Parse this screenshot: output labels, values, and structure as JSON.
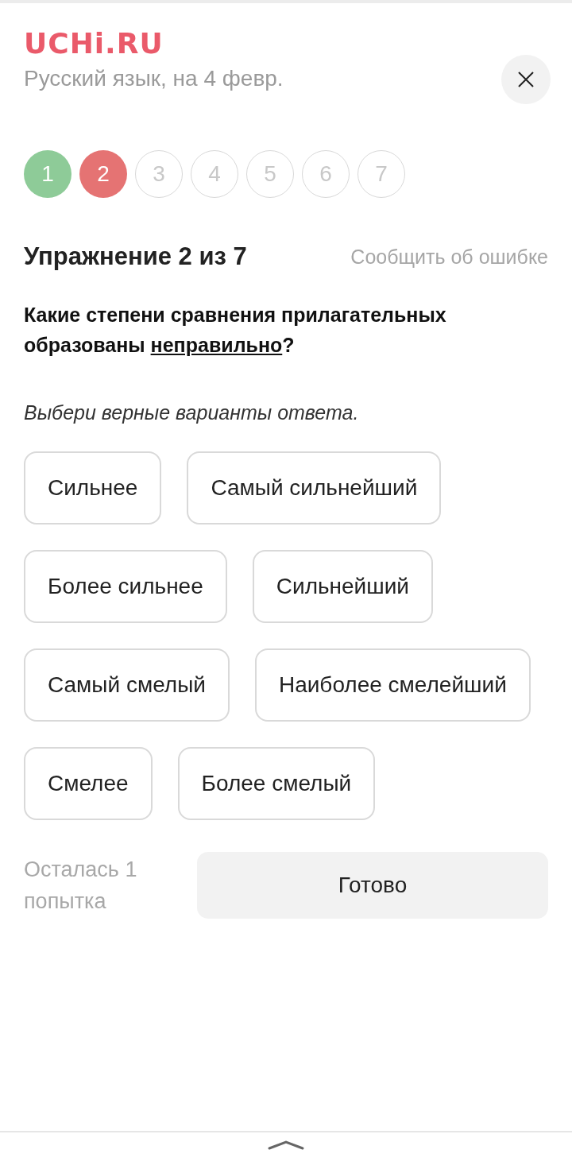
{
  "header": {
    "logo": "UCHi.RU",
    "subtitle": "Русский язык, на 4 февр."
  },
  "steps": [
    {
      "label": "1",
      "kind": "correct"
    },
    {
      "label": "2",
      "kind": "wrong"
    },
    {
      "label": "3",
      "kind": "pending"
    },
    {
      "label": "4",
      "kind": "pending"
    },
    {
      "label": "5",
      "kind": "pending"
    },
    {
      "label": "6",
      "kind": "pending"
    },
    {
      "label": "7",
      "kind": "pending"
    }
  ],
  "exercise": {
    "title": "Упражнение 2 из 7",
    "report_link": "Сообщить об ошибке"
  },
  "question": {
    "before": "Какие степени сравнения прилагательных образованы ",
    "underlined": "неправильно",
    "after": "?"
  },
  "instruction": "Выбери верные варианты ответа.",
  "option_rows": [
    [
      {
        "label": "Сильнее",
        "selected": false
      },
      {
        "label": "Самый сильнейший",
        "selected": false
      }
    ],
    [
      {
        "label": "Более сильнее",
        "selected": false
      },
      {
        "label": "Сильнейший",
        "selected": false
      }
    ],
    [
      {
        "label": "Самый смелый",
        "selected": false
      },
      {
        "label": "Наиболее смелейший",
        "selected": false
      }
    ],
    [
      {
        "label": "Смелее",
        "selected": false
      },
      {
        "label": "Более смелый",
        "selected": false
      }
    ]
  ],
  "attempts": "Осталась 1 попытка",
  "submit_button": "Готово"
}
